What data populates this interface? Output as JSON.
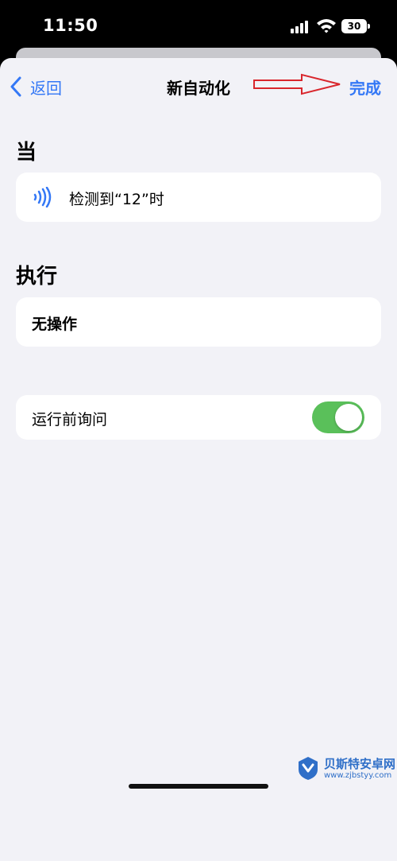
{
  "status_bar": {
    "time": "11:50",
    "battery_level": "30"
  },
  "nav": {
    "back_label": "返回",
    "title": "新自动化",
    "done_label": "完成"
  },
  "when_section": {
    "header": "当",
    "trigger_label": "检测到“12”时",
    "trigger_icon": "nfc-icon"
  },
  "do_section": {
    "header": "执行",
    "action_label": "无操作"
  },
  "ask_before_running": {
    "label": "运行前询问",
    "enabled": true
  },
  "watermark": {
    "title": "贝斯特安卓网",
    "url": "www.zjbstyy.com"
  },
  "colors": {
    "accent": "#3478f6",
    "toggle_on": "#5ac05a",
    "annotation_arrow": "#d9262c",
    "sheet_background": "#f2f2f7"
  }
}
